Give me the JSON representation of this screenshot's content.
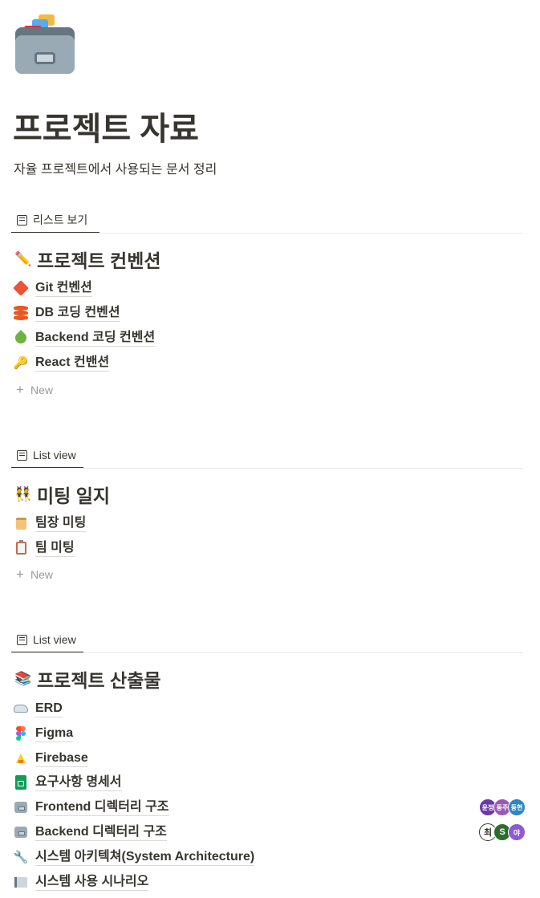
{
  "page": {
    "icon": "card-file-box-icon",
    "title": "프로젝트 자료",
    "description": "자율 프로젝트에서 사용되는 문서 정리"
  },
  "sections": [
    {
      "view_label": "리스트 보기",
      "heading_emoji": "✏️",
      "heading": "프로젝트 컨벤션",
      "items": [
        {
          "icon": "git-icon",
          "label": "Git 컨벤션"
        },
        {
          "icon": "database-icon",
          "label": "DB 코딩 컨벤션"
        },
        {
          "icon": "spring-icon",
          "label": "Backend 코딩 컨벤션"
        },
        {
          "icon": "key-icon",
          "label": "React 컨밴션"
        }
      ],
      "new_label": "New"
    },
    {
      "view_label": "List view",
      "heading_emoji": "👯",
      "heading": "미팅 일지",
      "items": [
        {
          "icon": "scroll-icon",
          "label": "팀장 미팅"
        },
        {
          "icon": "clipboard-icon",
          "label": "팀 미팅"
        }
      ],
      "new_label": "New"
    },
    {
      "view_label": "List view",
      "heading_emoji": "📚",
      "heading": "프로젝트 산출물",
      "items": [
        {
          "icon": "car-icon",
          "label": "ERD"
        },
        {
          "icon": "figma-icon",
          "label": "Figma"
        },
        {
          "icon": "firebase-icon",
          "label": "Firebase"
        },
        {
          "icon": "spreadsheet-icon",
          "label": "요구사항 명세서"
        },
        {
          "icon": "file-cabinet-icon",
          "label": "Frontend 디렉터리 구조",
          "avatars": [
            {
              "text": "윤정",
              "color": "#6a3aa8"
            },
            {
              "text": "동주",
              "color": "#9b59b6"
            },
            {
              "text": "동현",
              "color": "#2e86c1"
            }
          ]
        },
        {
          "icon": "file-cabinet-icon",
          "label": "Backend 디렉터리 구조",
          "avatars": [
            {
              "text": "최",
              "color": "#ffffff"
            },
            {
              "text": "S",
              "color": "#2e6b2e"
            },
            {
              "text": "야",
              "color": "#8e5ad0"
            }
          ]
        },
        {
          "icon": "wrench-icon",
          "label": "시스템 아키텍쳐(System Architecture)"
        },
        {
          "icon": "book-icon",
          "label": "시스템 사용 시나리오"
        }
      ]
    }
  ]
}
